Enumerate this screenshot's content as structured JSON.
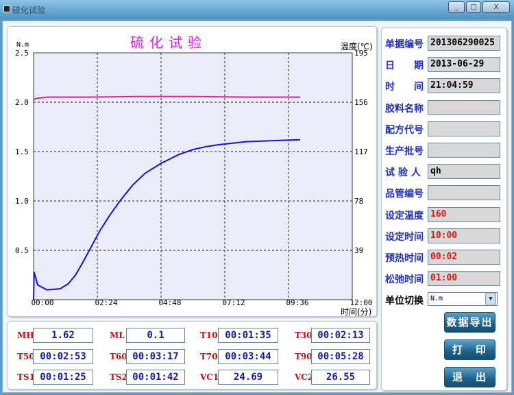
{
  "window": {
    "title": "硫化试验",
    "minimize": "_",
    "maximize": "□",
    "close": "X"
  },
  "chart_data": {
    "type": "line",
    "title": "硫化试验",
    "ylabel": "N.m",
    "y2label": "温度(℃)",
    "xlabel": "时间(分)",
    "xlim": [
      0,
      12
    ],
    "ylim": [
      0,
      2.5
    ],
    "y2lim": [
      0,
      195
    ],
    "xticks": [
      "00:00",
      "02:24",
      "04:48",
      "07:12",
      "09:36",
      "12:00"
    ],
    "yticks": [
      "2.5",
      "2.0",
      "1.5",
      "1.0",
      "0.5"
    ],
    "y2ticks": [
      "195",
      "156",
      "117",
      "78",
      "39"
    ],
    "grid": true,
    "series": [
      {
        "axis": "left",
        "color": "#1010e0",
        "x": [
          0,
          0.02,
          0.15,
          0.5,
          1.0,
          1.3,
          1.58,
          1.9,
          2.22,
          2.5,
          2.88,
          3.28,
          3.73,
          4.2,
          4.8,
          5.47,
          6.0,
          6.5,
          7.0,
          8.0,
          9.0,
          10.04
        ],
        "y": [
          0,
          0.28,
          0.15,
          0.1,
          0.11,
          0.16,
          0.25,
          0.4,
          0.56,
          0.7,
          0.86,
          1.01,
          1.16,
          1.28,
          1.38,
          1.47,
          1.52,
          1.55,
          1.57,
          1.6,
          1.61,
          1.62
        ]
      },
      {
        "axis": "right",
        "color": "#e0208a",
        "x": [
          0,
          0.1,
          0.5,
          2,
          4,
          6,
          8,
          10.04
        ],
        "y": [
          158,
          159,
          160,
          160,
          160.5,
          160.5,
          160,
          160
        ]
      }
    ]
  },
  "info": [
    {
      "label": "单据编号",
      "value": "201306290025",
      "red": false
    },
    {
      "label": "日　　期",
      "value": "2013-06-29",
      "red": false
    },
    {
      "label": "时　　间",
      "value": "21:04:59",
      "red": false
    },
    {
      "label": "胶料名称",
      "value": "",
      "red": false
    },
    {
      "label": "配方代号",
      "value": "",
      "red": false
    },
    {
      "label": "生产批号",
      "value": "",
      "red": false
    },
    {
      "label": "试 验 人",
      "value": "qh",
      "red": false
    },
    {
      "label": "品管编号",
      "value": "",
      "red": false
    },
    {
      "label": "设定温度",
      "value": "160",
      "red": true
    },
    {
      "label": "设定时间",
      "value": "10:00",
      "red": true
    },
    {
      "label": "预热时间",
      "value": "00:02",
      "red": true
    },
    {
      "label": "松弛时间",
      "value": "01:00",
      "red": true
    }
  ],
  "unit": {
    "label": "单位切换",
    "value": "N.m"
  },
  "buttons": {
    "export": "数据导出",
    "print": "打　印",
    "exit": "退　出"
  },
  "results": [
    {
      "label": "MH",
      "value": "1.62"
    },
    {
      "label": "ML",
      "value": "0.1"
    },
    {
      "label": "T10",
      "value": "00:01:35"
    },
    {
      "label": "T30",
      "value": "00:02:13"
    },
    {
      "label": "T50",
      "value": "00:02:53"
    },
    {
      "label": "T60",
      "value": "00:03:17"
    },
    {
      "label": "T70",
      "value": "00:03:44"
    },
    {
      "label": "T90",
      "value": "00:05:28"
    },
    {
      "label": "TS1",
      "value": "00:01:25"
    },
    {
      "label": "TS2",
      "value": "00:01:42"
    },
    {
      "label": "VC1",
      "value": "24.69"
    },
    {
      "label": "VC2",
      "value": "26.55"
    }
  ]
}
